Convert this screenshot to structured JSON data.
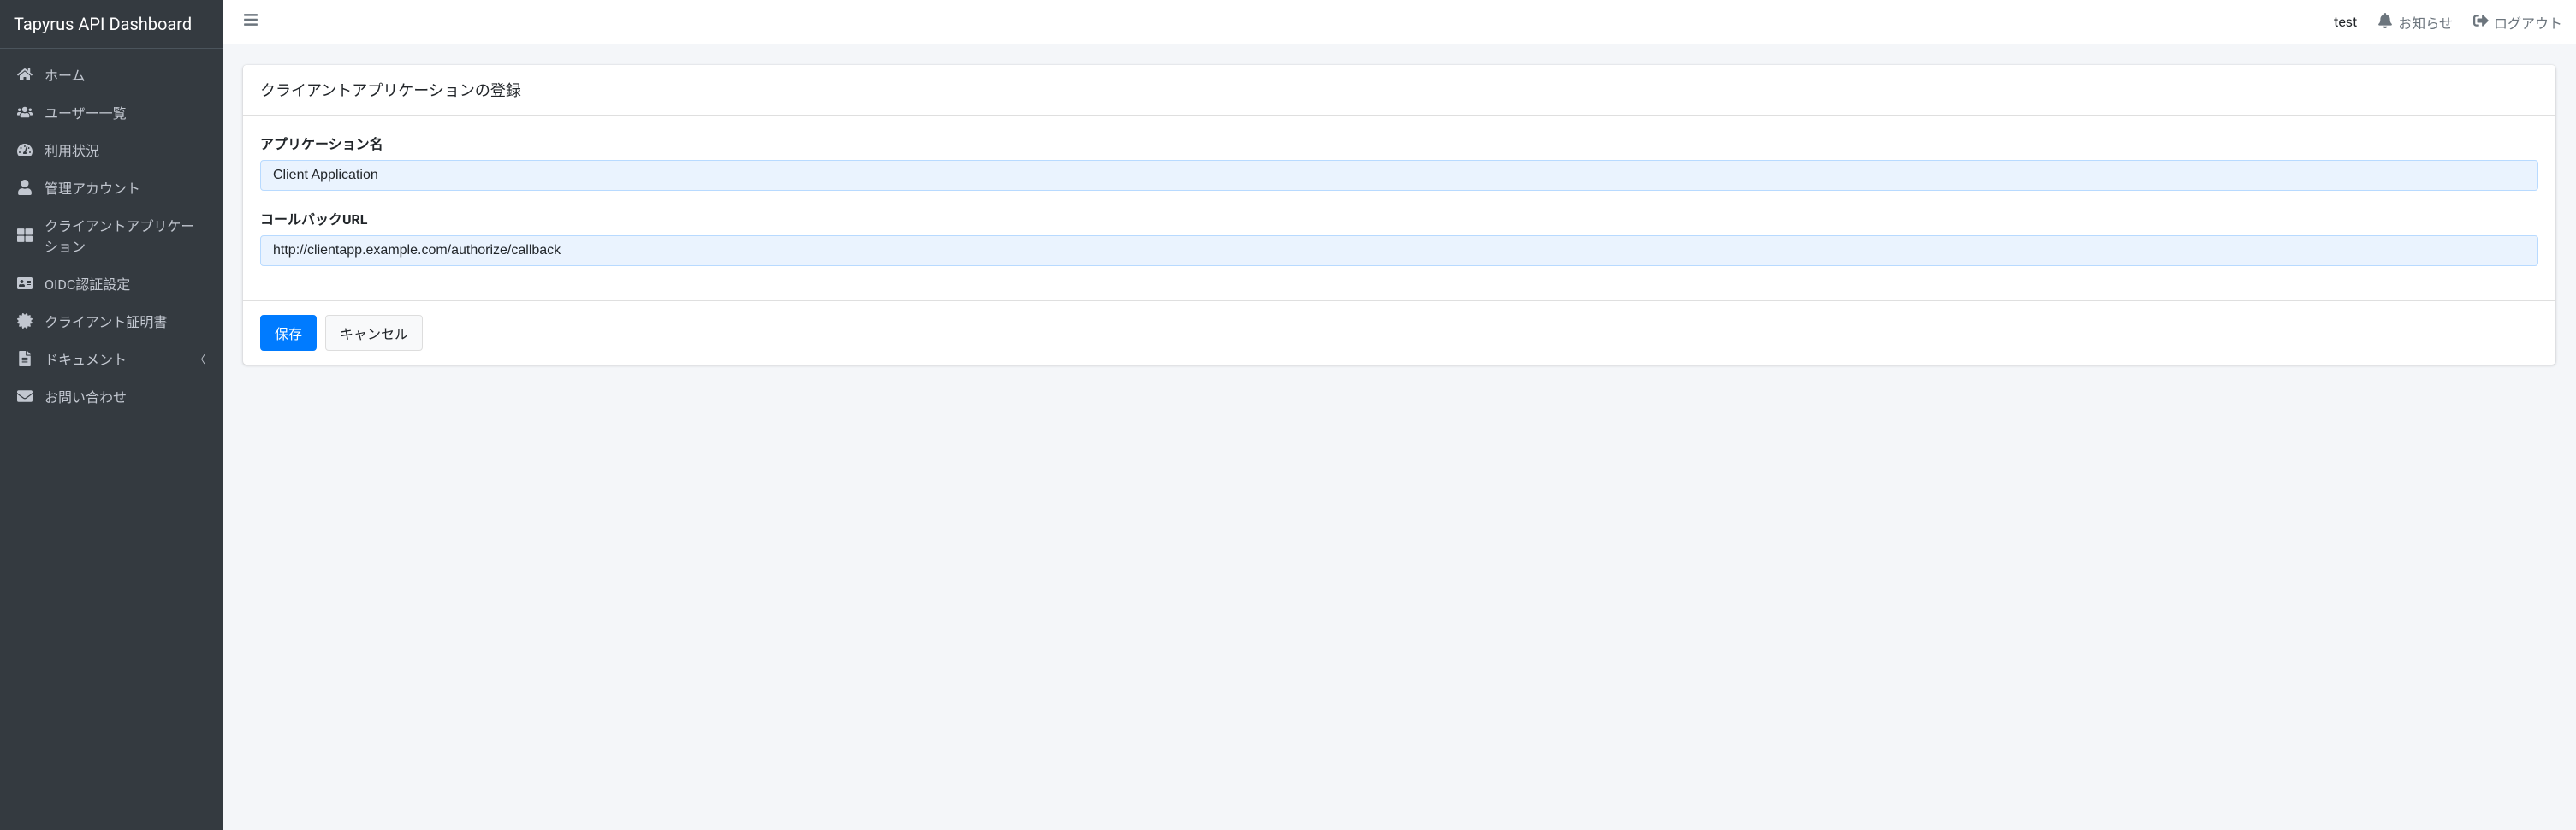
{
  "brand": "Tapyrus API Dashboard",
  "sidebar": {
    "items": [
      {
        "label": "ホーム"
      },
      {
        "label": "ユーザー一覧"
      },
      {
        "label": "利用状況"
      },
      {
        "label": "管理アカウント"
      },
      {
        "label": "クライアントアプリケーション"
      },
      {
        "label": "OIDC認証設定"
      },
      {
        "label": "クライアント証明書"
      },
      {
        "label": "ドキュメント"
      },
      {
        "label": "お問い合わせ"
      }
    ]
  },
  "topbar": {
    "user": "test",
    "notice": "お知らせ",
    "logout": "ログアウト"
  },
  "page": {
    "title": "クライアントアプリケーションの登録",
    "app_name_label": "アプリケーション名",
    "app_name_value": "Client Application",
    "callback_label": "コールバックURL",
    "callback_value": "http://clientapp.example.com/authorize/callback",
    "save_label": "保存",
    "cancel_label": "キャンセル"
  }
}
